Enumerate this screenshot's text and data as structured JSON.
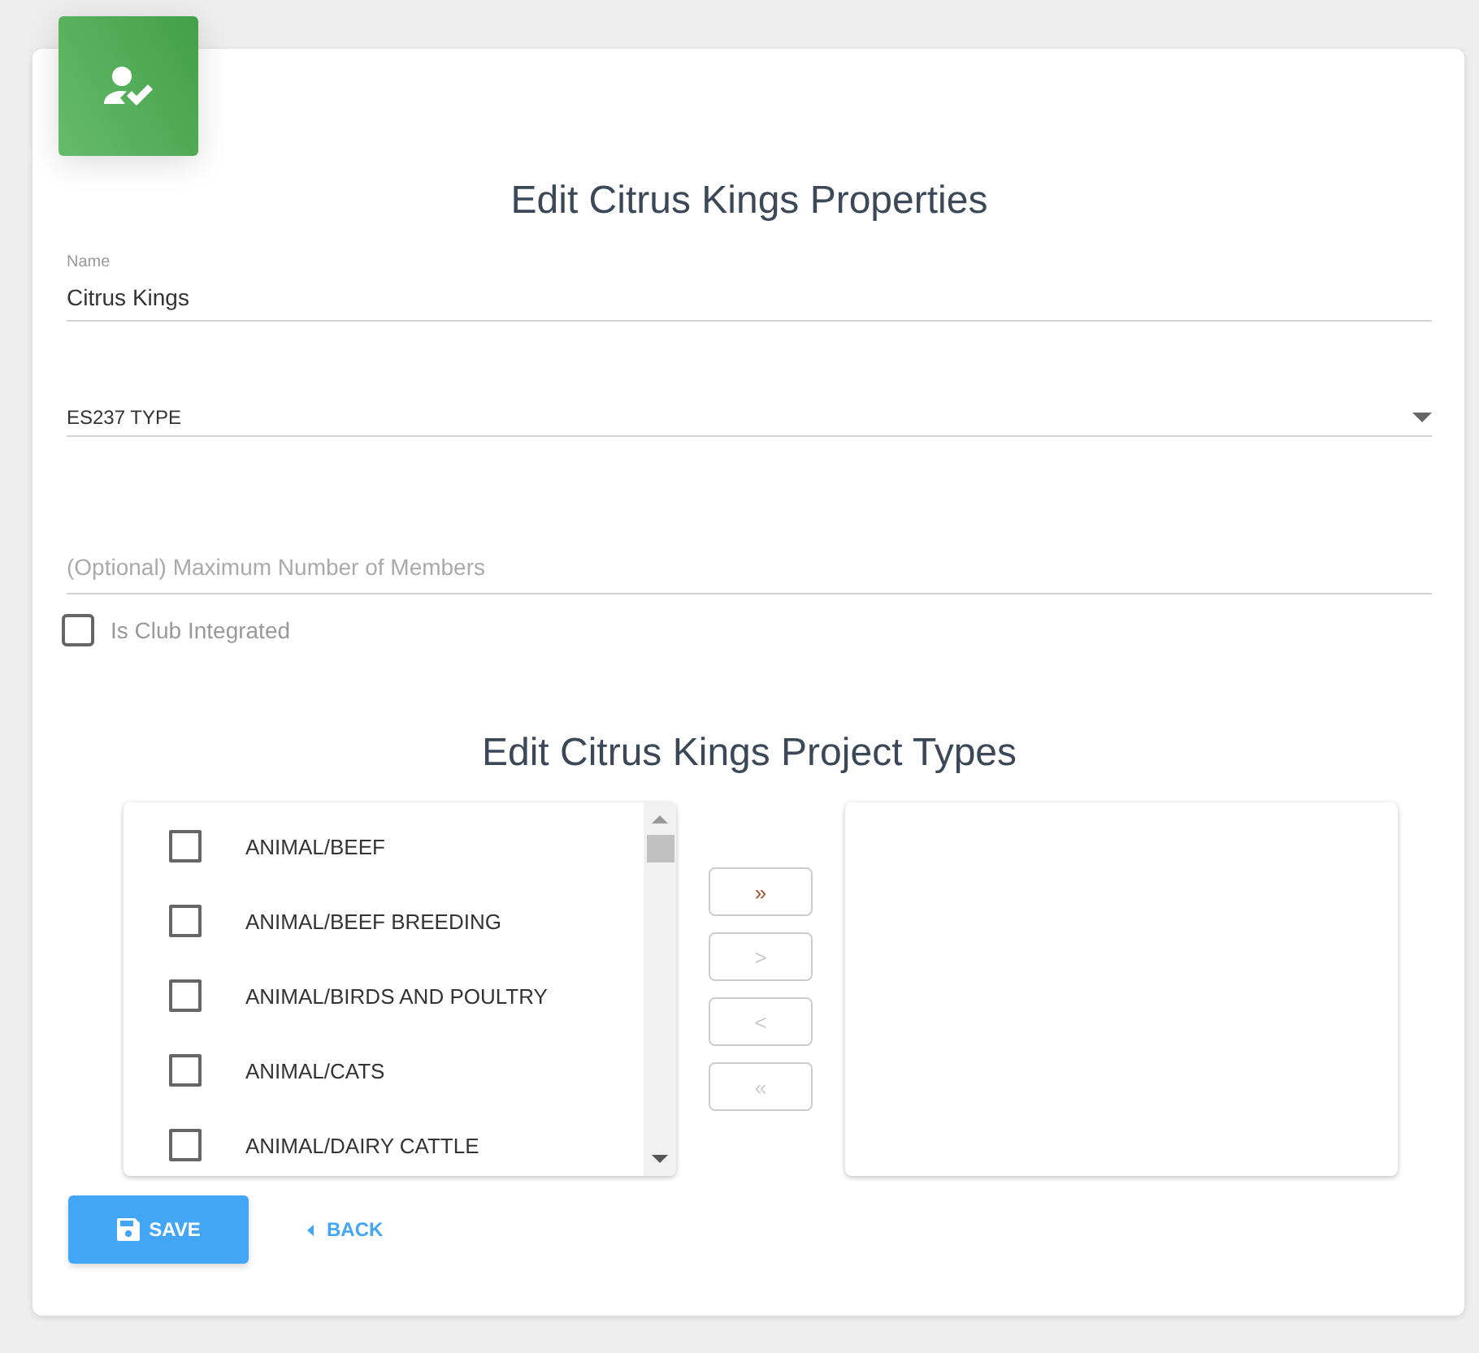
{
  "title": "Edit Citrus Kings Properties",
  "name_field": {
    "label": "Name",
    "value": "Citrus Kings"
  },
  "type_select": {
    "value": "ES237 TYPE"
  },
  "members_field": {
    "placeholder": "(Optional) Maximum Number of Members"
  },
  "club_integrated": {
    "label": "Is Club Integrated",
    "checked": false
  },
  "project_title": "Edit Citrus Kings Project Types",
  "available": [
    {
      "label": "ANIMAL/BEEF",
      "checked": false
    },
    {
      "label": "ANIMAL/BEEF BREEDING",
      "checked": false
    },
    {
      "label": "ANIMAL/BIRDS AND POULTRY",
      "checked": false
    },
    {
      "label": "ANIMAL/CATS",
      "checked": false
    },
    {
      "label": "ANIMAL/DAIRY CATTLE",
      "checked": false
    }
  ],
  "transfer_buttons": [
    {
      "label": "»",
      "disabled": false
    },
    {
      "label": ">",
      "disabled": true
    },
    {
      "label": "<",
      "disabled": true
    },
    {
      "label": "«",
      "disabled": true
    }
  ],
  "save_button": "SAVE",
  "back_link": "BACK"
}
